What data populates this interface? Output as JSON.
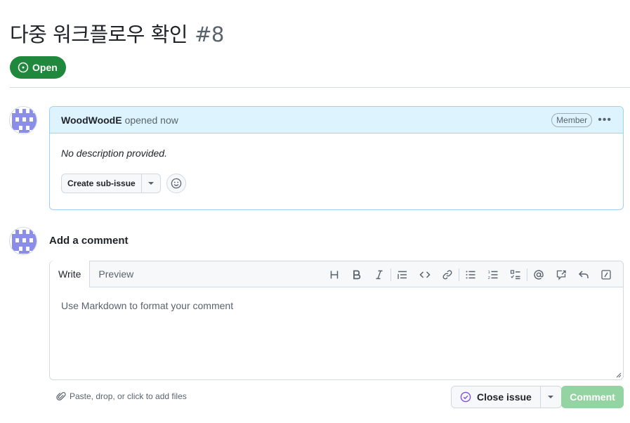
{
  "issue": {
    "title": "다중 워크플로우 확인",
    "number": "#8",
    "state": "Open"
  },
  "comment": {
    "author": "WoodWoodE",
    "meta": "opened now",
    "role": "Member",
    "body": "No description provided.",
    "create_sub_issue_label": "Create sub-issue"
  },
  "new_comment": {
    "heading": "Add a comment",
    "tabs": [
      "Write",
      "Preview"
    ],
    "placeholder": "Use Markdown to format your comment",
    "attach_label": "Paste, drop, or click to add files",
    "close_label": "Close issue",
    "submit_label": "Comment"
  },
  "toolbar_icons": [
    "heading-icon",
    "bold-icon",
    "italic-icon",
    "quote-icon",
    "code-icon",
    "link-icon",
    "unordered-list-icon",
    "ordered-list-icon",
    "task-list-icon",
    "mention-icon",
    "reference-icon",
    "saved-replies-icon",
    "slash-command-icon"
  ],
  "colors": {
    "open_green": "#1f883d",
    "header_blue": "#ddf4ff",
    "comment_disabled": "#94d3a2",
    "close_purple": "#8250df",
    "avatar_purple": "#8a8ee8"
  }
}
